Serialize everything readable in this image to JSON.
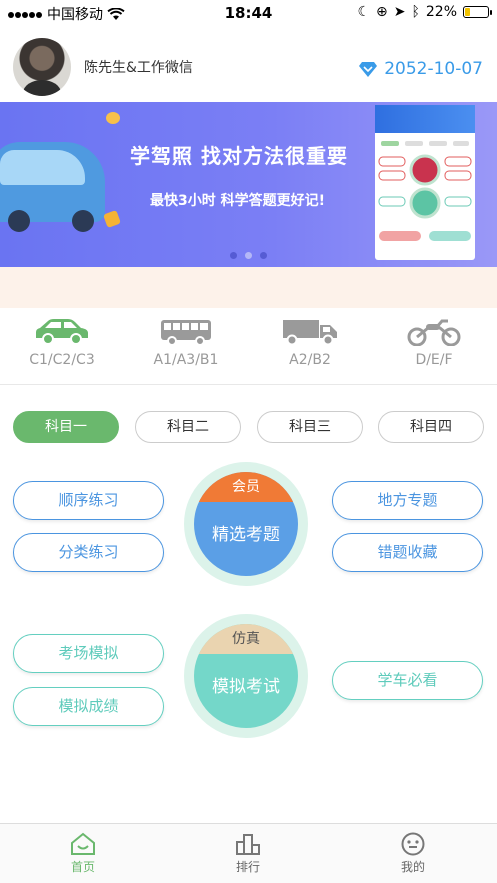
{
  "status_bar": {
    "carrier": "中国移动",
    "time": "18:44",
    "battery_text": "22%",
    "battery_level": 0.22,
    "icons": [
      "signal-dots-icon",
      "wifi-icon",
      "moon-icon",
      "lock-rotation-icon",
      "location-icon",
      "bluetooth-icon",
      "battery-icon"
    ]
  },
  "header": {
    "username": "陈先生&工作微信",
    "expiry_date": "2052-10-07",
    "expiry_icon": "diamond-icon"
  },
  "banner": {
    "title": "学驾照 找对方法很重要",
    "subtitle": "最快3小时  科学答题更好记!",
    "page_count": 3,
    "active_page": 2
  },
  "license_types": [
    {
      "label": "C1/C2/C3",
      "icon": "car-icon",
      "active": true
    },
    {
      "label": "A1/A3/B1",
      "icon": "bus-icon",
      "active": false
    },
    {
      "label": "A2/B2",
      "icon": "truck-icon",
      "active": false
    },
    {
      "label": "D/E/F",
      "icon": "motorcycle-icon",
      "active": false
    }
  ],
  "subjects": [
    "科目一",
    "科目二",
    "科目三",
    "科目四"
  ],
  "active_subject": "科目一",
  "practice": {
    "sequential": "顺序练习",
    "category": "分类练习",
    "featured_badge": "会员",
    "featured_title": "精选考题",
    "regional": "地方专题",
    "mistakes": "错题收藏"
  },
  "exam": {
    "venue_sim": "考场模拟",
    "sim_scores": "模拟成绩",
    "badge": "仿真",
    "title": "模拟考试",
    "must_watch": "学车必看"
  },
  "bottom_nav": [
    {
      "label": "首页",
      "icon": "home-icon",
      "active": true
    },
    {
      "label": "排行",
      "icon": "ranking-icon",
      "active": false
    },
    {
      "label": "我的",
      "icon": "profile-face-icon",
      "active": false
    }
  ],
  "colors": {
    "accent_green": "#6ab86d",
    "accent_blue": "#4b95e0",
    "teal": "#5ecbbb",
    "expiry_blue": "#3a9be8",
    "banner_purple": "#6a74f2",
    "member_orange": "#f07a36",
    "sim_beige": "#e8d2ae"
  }
}
